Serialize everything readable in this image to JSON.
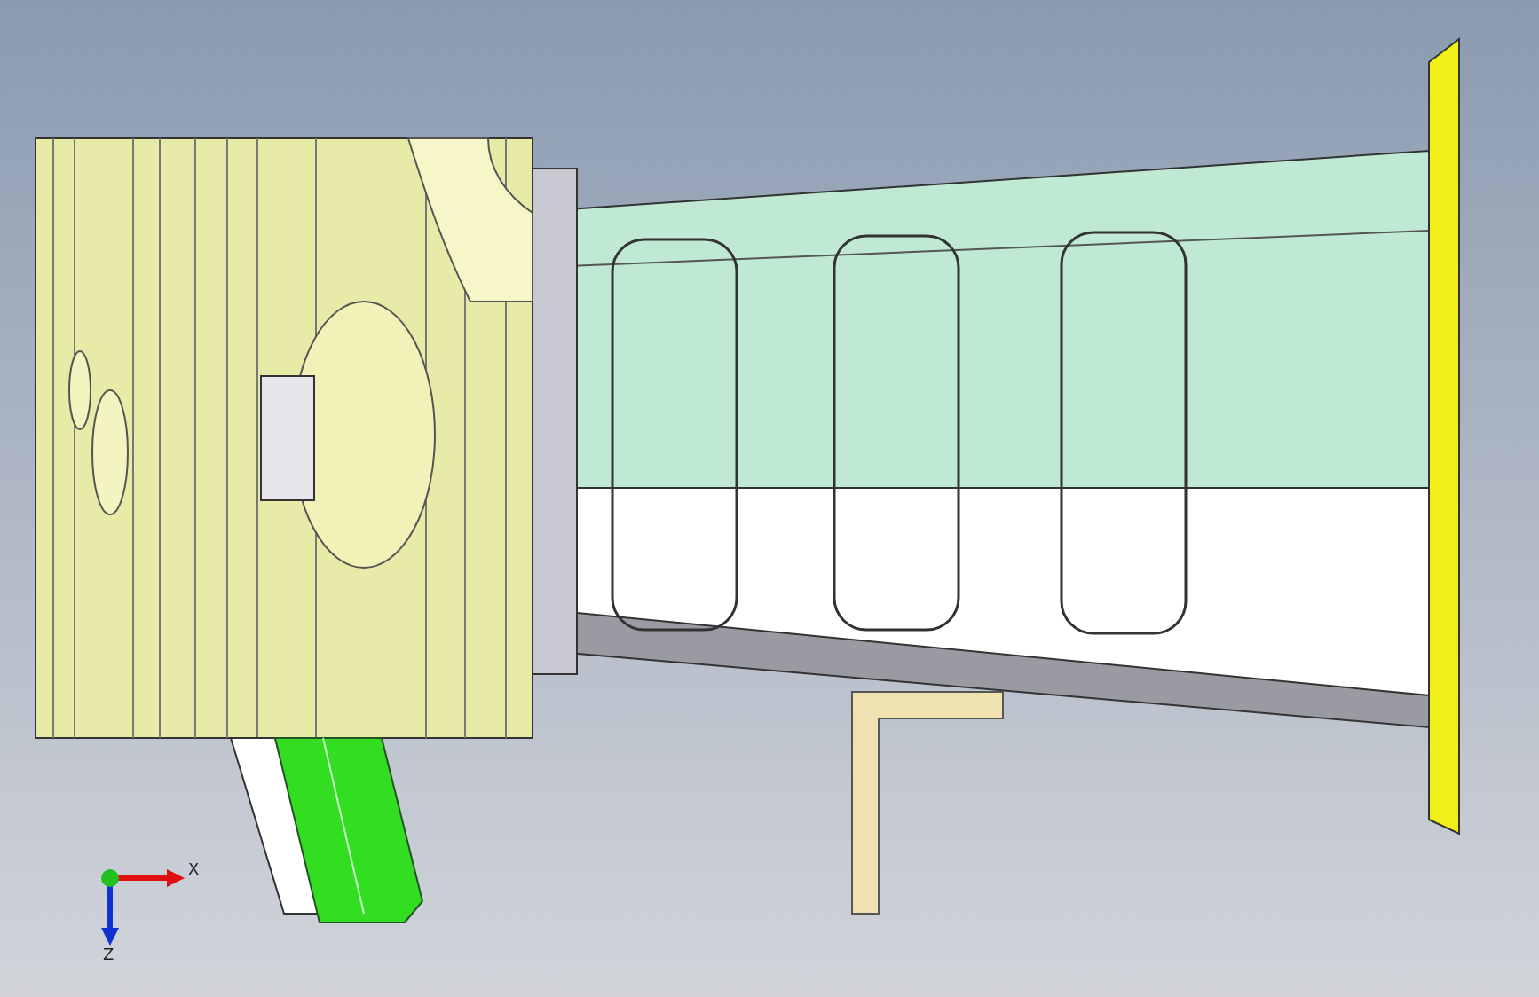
{
  "viewport": {
    "axes": [
      {
        "kind": "x",
        "label": "X"
      },
      {
        "kind": "z",
        "label": "Z"
      }
    ]
  }
}
